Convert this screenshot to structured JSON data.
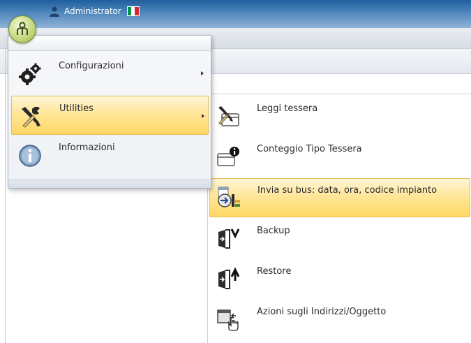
{
  "titlebar": {
    "user_label": "Administrator",
    "flag_colors": [
      "#009246",
      "#ffffff",
      "#ce2b37"
    ]
  },
  "main_menu": {
    "items": [
      {
        "label": "Configurazioni",
        "icon": "gears-icon",
        "has_submenu": true,
        "selected": false
      },
      {
        "label": "Utilities",
        "icon": "tools-icon",
        "has_submenu": true,
        "selected": true
      },
      {
        "label": "Informazioni",
        "icon": "info-icon",
        "has_submenu": false,
        "selected": false
      }
    ]
  },
  "utilities_submenu": {
    "items": [
      {
        "label": "Leggi tessera",
        "icon": "read-card-icon",
        "selected": false
      },
      {
        "label": "Conteggio Tipo Tessera",
        "icon": "card-info-icon",
        "selected": false
      },
      {
        "label": "Invia su bus: data, ora, codice impianto",
        "icon": "send-bus-icon",
        "selected": true
      },
      {
        "label": "Backup",
        "icon": "backup-icon",
        "selected": false
      },
      {
        "label": "Restore",
        "icon": "restore-icon",
        "selected": false
      },
      {
        "label": "Azioni sugli Indirizzi/Oggetto",
        "icon": "address-actions-icon",
        "selected": false
      }
    ]
  },
  "colors": {
    "highlight": "#ffe69a",
    "titlebar": "#4f86bd",
    "orb": "#cfdf8e"
  }
}
